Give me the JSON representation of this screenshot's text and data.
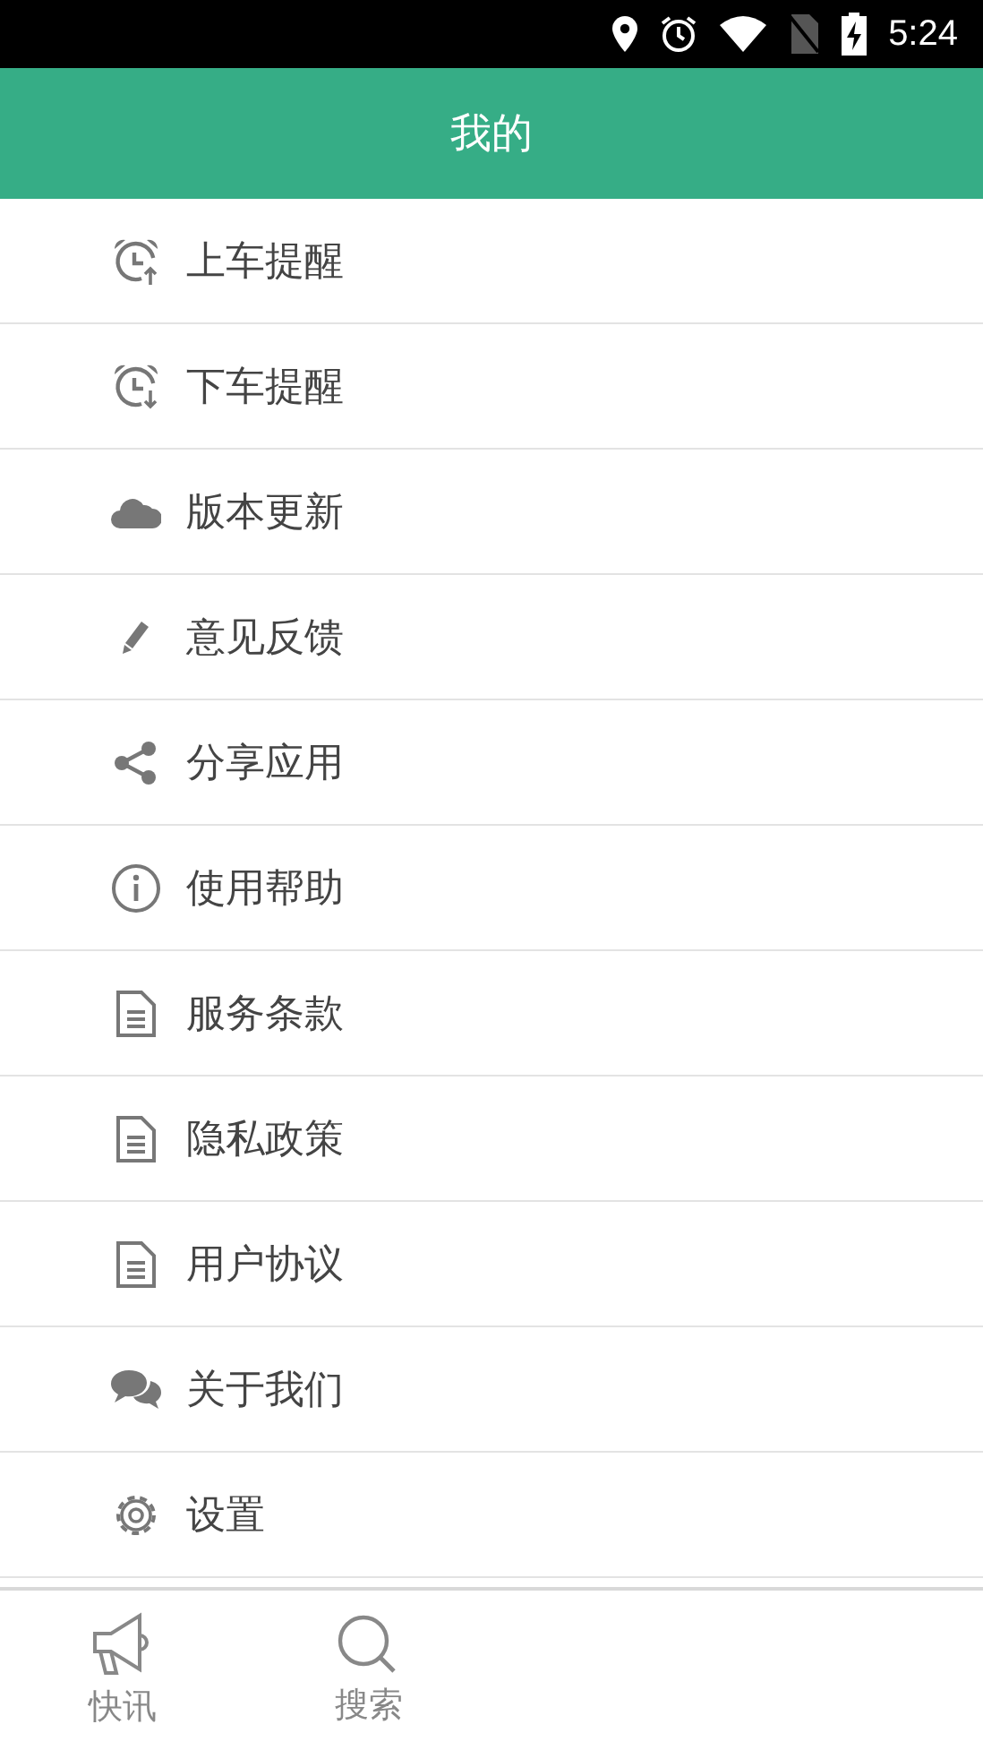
{
  "status_bar": {
    "time": "5:24"
  },
  "header": {
    "title": "我的"
  },
  "menu": [
    {
      "label": "上车提醒",
      "kind": "alarm-up"
    },
    {
      "label": "下车提醒",
      "kind": "alarm-down"
    },
    {
      "label": "版本更新",
      "kind": "cloud"
    },
    {
      "label": "意见反馈",
      "kind": "pencil"
    },
    {
      "label": "分享应用",
      "kind": "share"
    },
    {
      "label": "使用帮助",
      "kind": "info"
    },
    {
      "label": "服务条款",
      "kind": "document"
    },
    {
      "label": "隐私政策",
      "kind": "document"
    },
    {
      "label": "用户协议",
      "kind": "document"
    },
    {
      "label": "关于我们",
      "kind": "chat"
    },
    {
      "label": "设置",
      "kind": "gear"
    }
  ],
  "bottom_tabs": [
    {
      "label": "快讯",
      "kind": "megaphone",
      "selected": false
    },
    {
      "label": "搜索",
      "kind": "search",
      "selected": false
    }
  ]
}
